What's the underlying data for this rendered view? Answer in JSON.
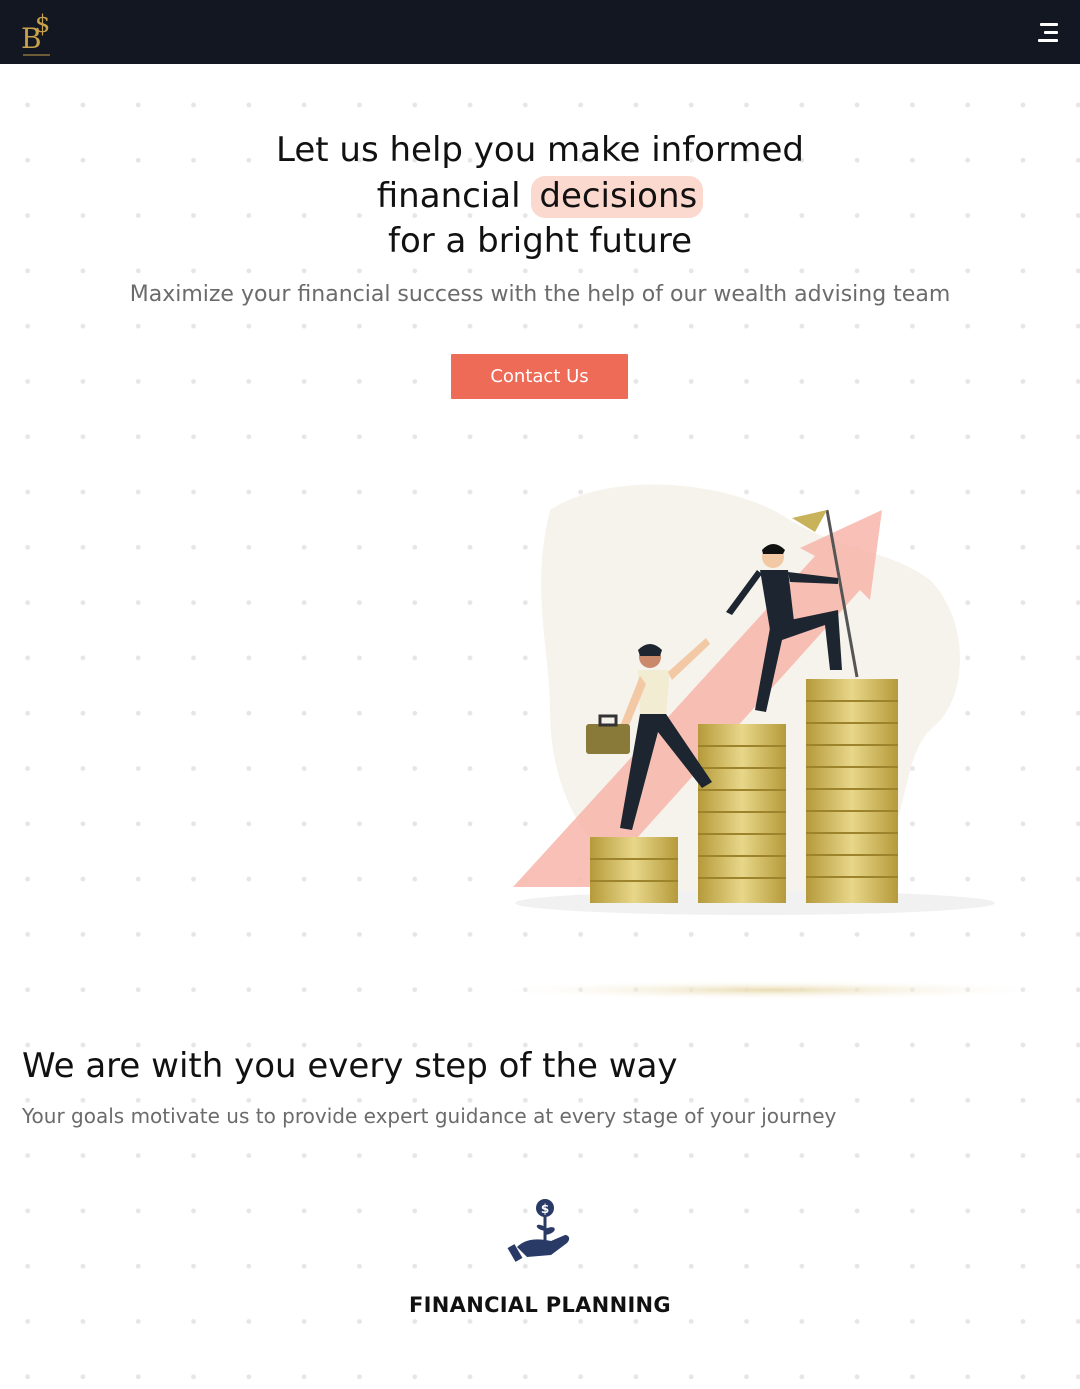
{
  "navbar": {
    "logo_icon": "bitcoin-dollar-logo",
    "menu_icon": "hamburger-menu-icon",
    "background": "#121722"
  },
  "hero": {
    "title_line1": "Let us help you make informed",
    "title_line2_prefix": "financial",
    "title_line2_highlight": "decisions",
    "title_line3": "for a bright future",
    "subtitle": "Maximize your financial success with the help of our wealth advising team",
    "cta_label": "Contact Us",
    "cta_color": "#ee6b57",
    "highlight_color": "#fcd9cf"
  },
  "section": {
    "title": "We are with you every step of the way",
    "subtitle": "Your goals motivate us to provide expert guidance at every stage of your journey"
  },
  "services": [
    {
      "icon": "money-plant-hand-icon",
      "label": "FINANCIAL PLANNING"
    }
  ]
}
